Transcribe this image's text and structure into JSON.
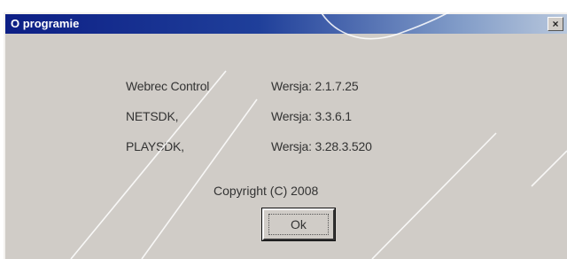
{
  "dialog": {
    "title": "O programie",
    "close_glyph": "×"
  },
  "components": [
    {
      "name": "Webrec Control",
      "version": "Wersja: 2.1.7.25"
    },
    {
      "name": "NETSDK,",
      "version": "Wersja: 3.3.6.1"
    },
    {
      "name": "PLAYSDK,",
      "version": "Wersja: 3.28.3.520"
    }
  ],
  "copyright": "Copyright (C) 2008",
  "ok_button": {
    "label": "Ok"
  },
  "colors": {
    "title_start": "#0d1f85",
    "title_end": "#b8c7dc",
    "dialog_bg": "#d0ccc7"
  }
}
